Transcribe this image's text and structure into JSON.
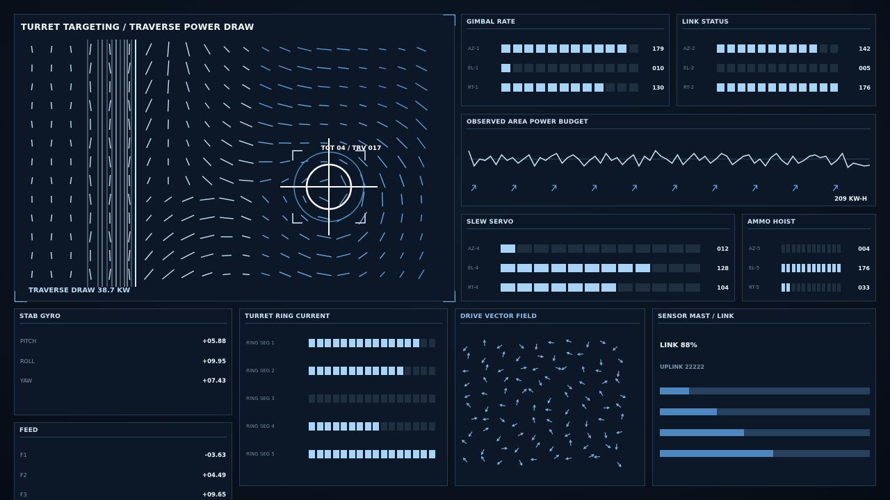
{
  "targeting": {
    "title": "TURRET TARGETING / TRAVERSE POWER DRAW",
    "reticle_label": "TGT 04 / TRV 017",
    "draw_label": "TRAVERSE DRAW 38.7 KW"
  },
  "gimbal": {
    "title": "GIMBAL RATE",
    "rows": [
      {
        "label": "AZ-1",
        "value": "179",
        "level": 0.92
      },
      {
        "label": "EL-1",
        "value": "010",
        "level": 0.08
      },
      {
        "label": "RT-1",
        "value": "130",
        "level": 0.75
      }
    ]
  },
  "link_status": {
    "title": "LINK STATUS",
    "rows": [
      {
        "label": "AZ-2",
        "value": "142",
        "level": 0.83
      },
      {
        "label": "EL-2",
        "value": "005",
        "level": 0.0
      },
      {
        "label": "RT-2",
        "value": "176",
        "level": 1.0
      }
    ]
  },
  "power_budget": {
    "title": "OBSERVED AREA POWER BUDGET",
    "value": "209 KW-H"
  },
  "slew": {
    "title": "SLEW SERVO",
    "rows": [
      {
        "label": "AZ-4",
        "value": "012",
        "level": 0.08
      },
      {
        "label": "EL-4",
        "value": "128",
        "level": 0.75
      },
      {
        "label": "RT-4",
        "value": "104",
        "level": 0.58
      }
    ]
  },
  "ammo": {
    "title": "AMMO HOIST",
    "rows": [
      {
        "label": "AZ-5",
        "value": "004",
        "level": 0.0
      },
      {
        "label": "EL-5",
        "value": "176",
        "level": 1.0
      },
      {
        "label": "RT-5",
        "value": "033",
        "level": 0.14
      }
    ]
  },
  "stab": {
    "title": "STAB GYRO",
    "rows": [
      {
        "label": "PITCH",
        "value": "+05.88"
      },
      {
        "label": "ROLL",
        "value": "+09.95"
      },
      {
        "label": "YAW",
        "value": "+07.43"
      }
    ]
  },
  "feed": {
    "title": "FEED",
    "rows": [
      {
        "label": "F1",
        "value": "-03.63"
      },
      {
        "label": "F2",
        "value": "+04.49"
      },
      {
        "label": "F3",
        "value": "+09.65"
      }
    ]
  },
  "ring": {
    "title": "TURRET RING CURRENT",
    "rows": [
      {
        "label": "RING SEG 1",
        "level": 0.86
      },
      {
        "label": "RING SEG 2",
        "level": 0.76
      },
      {
        "label": "RING SEG 3",
        "level": 0.0
      },
      {
        "label": "RING SEG 4",
        "level": 0.57
      },
      {
        "label": "RING SEG 5",
        "level": 1.0
      }
    ]
  },
  "drive": {
    "title": "DRIVE VECTOR FIELD"
  },
  "sensor": {
    "title": "SENSOR MAST / LINK",
    "link": "LINK 88%",
    "uplink": "UPLINK 22222",
    "bars": [
      0.14,
      0.27,
      0.4,
      0.54
    ]
  },
  "colors": {
    "accent": "#a9d3f5",
    "dim": "#1f2f40",
    "panel": "#0c1828",
    "border": "#263a52",
    "bar_fill": "#4f88be"
  }
}
